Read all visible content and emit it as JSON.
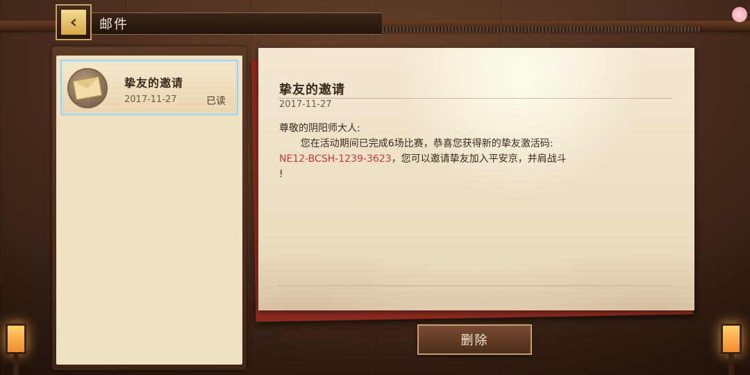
{
  "header": {
    "title": "邮件",
    "back_icon": "chevron-left-icon"
  },
  "mail_list": {
    "items": [
      {
        "title": "挚友的邀请",
        "date": "2017-11-27",
        "status": "已读",
        "icon": "envelope-icon",
        "selected": true
      }
    ]
  },
  "letter": {
    "title": "挚友的邀请",
    "date": "2017-11-27",
    "greeting": "尊敬的阴阳师大人:",
    "line1": "您在活动期间已完成6场比赛，恭喜您获得新的挚友激活码:",
    "code": "NE12-BCSH-1239-3623",
    "line2_rest": "，您可以邀请挚友加入平安京，并肩战斗",
    "line3": "!"
  },
  "actions": {
    "delete_label": "删除"
  },
  "colors": {
    "accent_code": "#c73838",
    "selected_border": "#9cd3f2"
  }
}
